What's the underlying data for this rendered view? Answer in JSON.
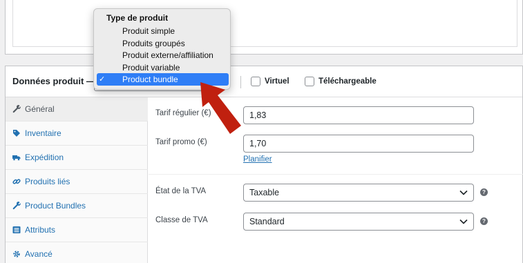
{
  "product_data": {
    "title": "Données produit —",
    "virtual_label": "Virtuel",
    "downloadable_label": "Téléchargeable"
  },
  "tabs": [
    {
      "label": "Général",
      "icon": "wrench-icon",
      "active": true
    },
    {
      "label": "Inventaire",
      "icon": "tag-icon",
      "active": false
    },
    {
      "label": "Expédition",
      "icon": "truck-icon",
      "active": false
    },
    {
      "label": "Produits liés",
      "icon": "link-icon",
      "active": false
    },
    {
      "label": "Product Bundles",
      "icon": "wrench-icon",
      "active": false
    },
    {
      "label": "Attributs",
      "icon": "list-icon",
      "active": false
    },
    {
      "label": "Avancé",
      "icon": "gear-icon",
      "active": false
    }
  ],
  "fields": {
    "regular_price_label": "Tarif régulier (€)",
    "regular_price_value": "1,83",
    "sale_price_label": "Tarif promo (€)",
    "sale_price_value": "1,70",
    "schedule_link": "Planifier",
    "tax_status_label": "État de la TVA",
    "tax_status_value": "Taxable",
    "tax_class_label": "Classe de TVA",
    "tax_class_value": "Standard"
  },
  "dropdown": {
    "group_label": "Type de produit",
    "options": [
      "Produit simple",
      "Produits groupés",
      "Produit externe/affiliation",
      "Produit variable",
      "Product bundle"
    ],
    "selected": "Product bundle",
    "check_glyph": "✓"
  },
  "colors": {
    "link": "#2271b1",
    "highlight": "#2f7ef6",
    "arrow": "#c0200f"
  }
}
